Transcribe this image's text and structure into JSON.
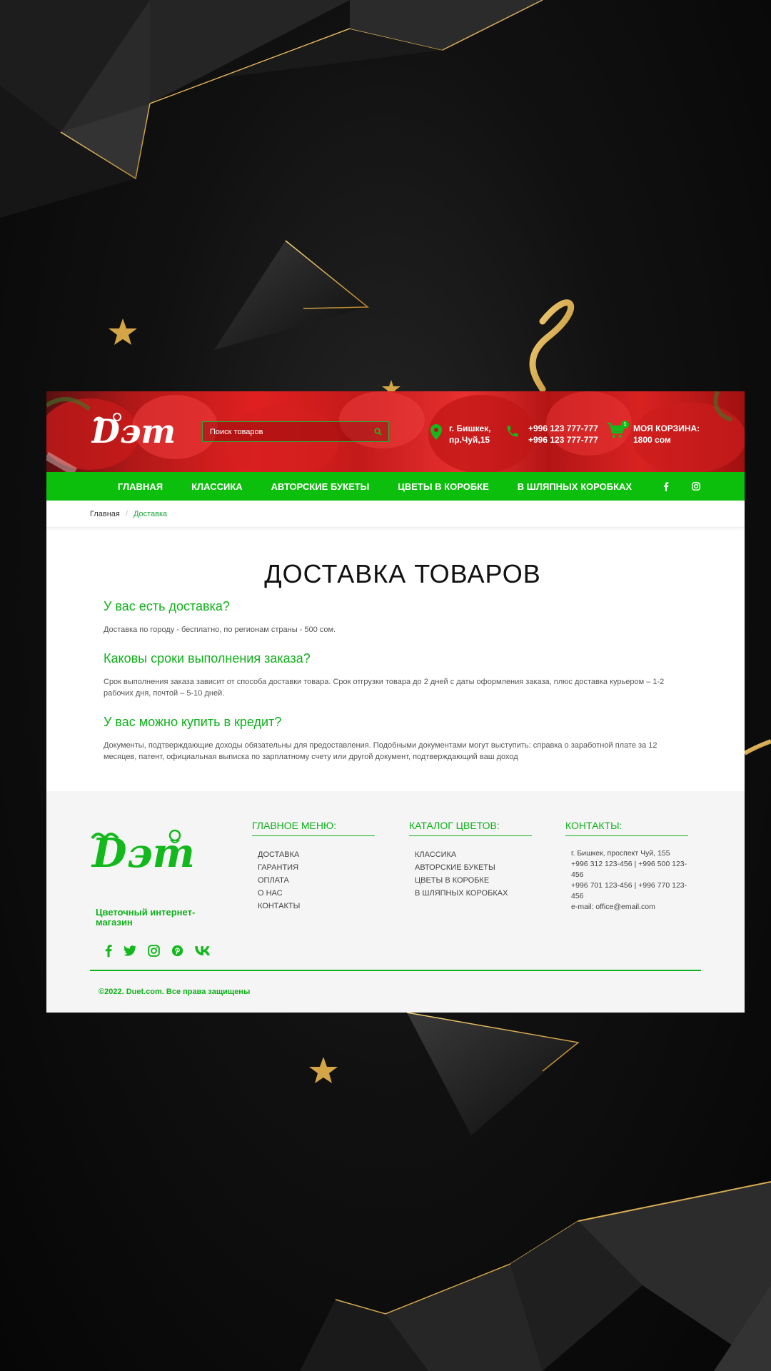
{
  "header": {
    "logo_alt": "Дуэт",
    "search_placeholder": "Поиск товаров",
    "address_line1": "г. Бишкек,",
    "address_line2": "пр.Чуй,15",
    "phone1": "+996 123 777-777",
    "phone2": "+996 123 777-777",
    "cart_label": "МОЯ КОРЗИНА:",
    "cart_total": "1800 сом",
    "cart_count": "1"
  },
  "nav": {
    "items": [
      "ГЛАВНАЯ",
      "КЛАССИКА",
      "АВТОРСКИЕ БУКЕТЫ",
      "ЦВЕТЫ В КОРОБКЕ",
      "В ШЛЯПНЫХ КОРОБКАХ"
    ],
    "social": [
      "facebook-icon",
      "instagram-icon"
    ]
  },
  "breadcrumb": {
    "home": "Главная",
    "current": "Доставка"
  },
  "content": {
    "title": "ДОСТАВКА ТОВАРОВ",
    "sections": [
      {
        "heading": "У вас есть доставка?",
        "text": "Доставка по городу - бесплатно, по регионам страны - 500 сом."
      },
      {
        "heading": "Каковы сроки выполнения заказа?",
        "text": "Срок выполнения заказа зависит от способа доставки товара. Срок отгрузки товара до 2 дней с даты оформления заказа, плюс доставка курьером – 1-2 рабочих дня, почтой – 5-10 дней."
      },
      {
        "heading": "У вас можно купить в кредит?",
        "text": "Документы, подтверждающие доходы обязательны для предоставления. Подобными документами могут выступить: справка о заработной плате за 12 месяцев, патент, официальная выписка по зарплатному счету или другой документ, подтверждающий ваш доход"
      }
    ]
  },
  "footer": {
    "tagline": "Цветочный интернет-магазин",
    "menu_title": "ГЛАВНОЕ МЕНЮ:",
    "menu": [
      "ДОСТАВКА",
      "ГАРАНТИЯ",
      "ОПЛАТА",
      "О НАС",
      "КОНТАКТЫ"
    ],
    "catalog_title": "КАТАЛОГ ЦВЕТОВ:",
    "catalog": [
      "КЛАССИКА",
      "АВТОРСКИЕ БУКЕТЫ",
      "ЦВЕТЫ В КОРОБКЕ",
      "В ШЛЯПНЫХ КОРОБКАХ"
    ],
    "contacts_title": "КОНТАКТЫ:",
    "contacts": [
      "г. Бишкек, проспект Чуй, 155",
      "+996 312 123-456 | +996 500 123-456",
      "+996 701 123-456 | +996 770 123-456",
      "e-mail: office@email.com"
    ],
    "social": [
      "facebook-icon",
      "twitter-icon",
      "instagram-icon",
      "pinterest-icon",
      "vk-icon"
    ],
    "copyright": "©2022. Duet.com. Все права защищены"
  },
  "colors": {
    "accent_green": "#0dbf0d",
    "text_green": "#0fb01a",
    "header_red": "#e02020",
    "gold": "#d4a547"
  }
}
